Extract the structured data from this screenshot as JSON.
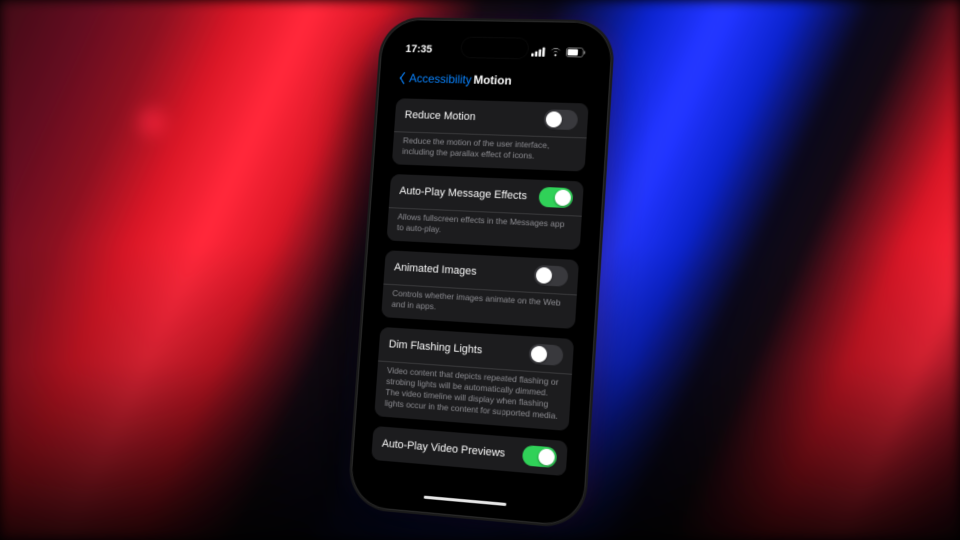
{
  "statusbar": {
    "time": "17:35"
  },
  "nav": {
    "back_label": "Accessibility",
    "title": "Motion"
  },
  "settings": [
    {
      "label": "Reduce Motion",
      "enabled": false,
      "footer": "Reduce the motion of the user interface, including the parallax effect of icons."
    },
    {
      "label": "Auto-Play Message Effects",
      "enabled": true,
      "footer": "Allows fullscreen effects in the Messages app to auto-play."
    },
    {
      "label": "Animated Images",
      "enabled": false,
      "footer": "Controls whether images animate on the Web and in apps."
    },
    {
      "label": "Dim Flashing Lights",
      "enabled": false,
      "footer": "Video content that depicts repeated flashing or strobing lights will be automatically dimmed. The video timeline will display when flashing lights occur in the content for supported media."
    },
    {
      "label": "Auto-Play Video Previews",
      "enabled": true,
      "footer": ""
    }
  ],
  "colors": {
    "accent_blue": "#0a84ff",
    "toggle_on": "#30d158"
  }
}
